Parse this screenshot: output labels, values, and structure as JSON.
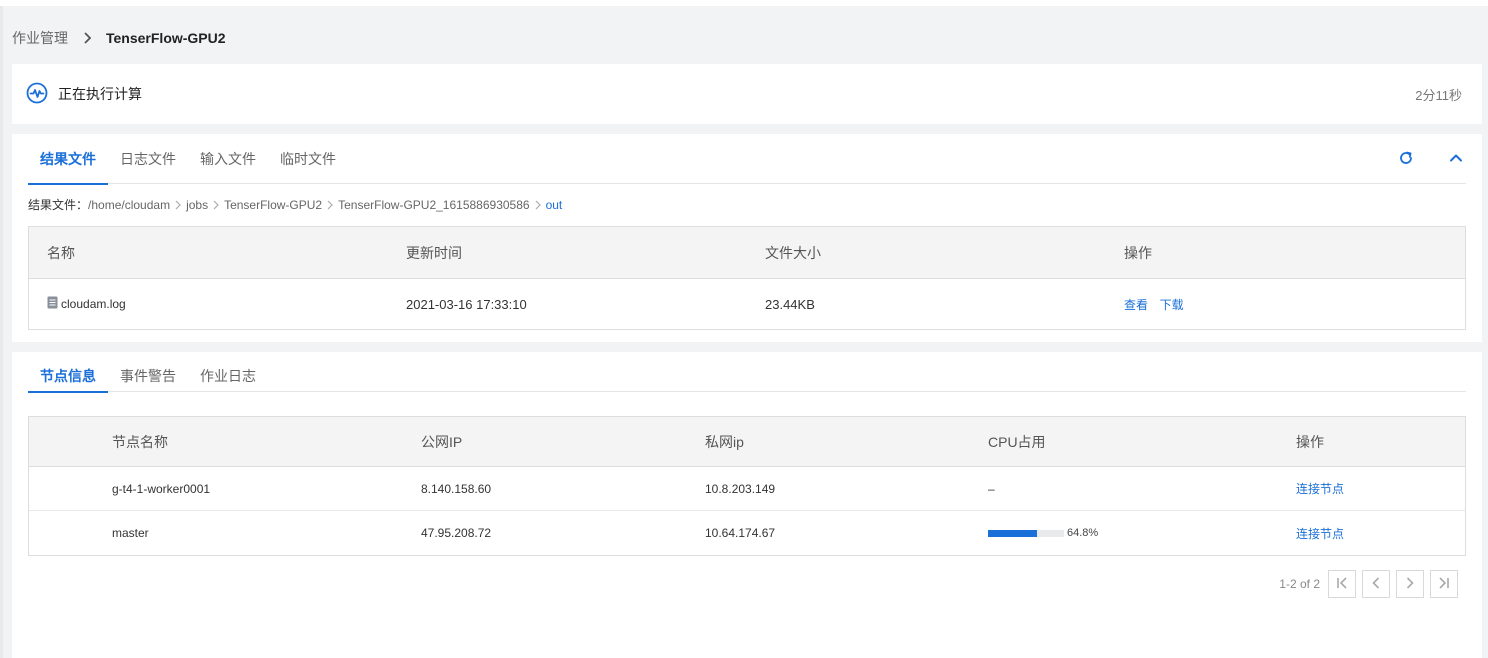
{
  "breadcrumb": {
    "parent": "作业管理",
    "current": "TenserFlow-GPU2"
  },
  "status": {
    "text": "正在执行计算",
    "elapsed": "2分11秒"
  },
  "file_tabs": [
    {
      "label": "结果文件",
      "active": true
    },
    {
      "label": "日志文件",
      "active": false
    },
    {
      "label": "输入文件",
      "active": false
    },
    {
      "label": "临时文件",
      "active": false
    }
  ],
  "path": {
    "label": "结果文件：",
    "segments": [
      "/home/cloudam",
      "jobs",
      "TenserFlow-GPU2",
      "TenserFlow-GPU2_1615886930586",
      "out"
    ]
  },
  "files_table": {
    "headers": [
      "名称",
      "更新时间",
      "文件大小",
      "操作"
    ],
    "rows": [
      {
        "name": "cloudam.log",
        "updated": "2021-03-16 17:33:10",
        "size": "23.44KB",
        "actions": [
          "查看",
          "下载"
        ]
      }
    ]
  },
  "node_tabs": [
    {
      "label": "节点信息",
      "active": true
    },
    {
      "label": "事件警告",
      "active": false
    },
    {
      "label": "作业日志",
      "active": false
    }
  ],
  "nodes_table": {
    "headers": [
      "节点名称",
      "公网IP",
      "私网ip",
      "CPU占用",
      "操作"
    ],
    "rows": [
      {
        "name": "g-t4-1-worker0001",
        "public_ip": "8.140.158.60",
        "private_ip": "10.8.203.149",
        "cpu_text": "–",
        "cpu_percent": null,
        "action": "连接节点"
      },
      {
        "name": "master",
        "public_ip": "47.95.208.72",
        "private_ip": "10.64.174.67",
        "cpu_text": "64.8%",
        "cpu_percent": 64.8,
        "action": "连接节点"
      }
    ]
  },
  "pagination": {
    "range": "1-2 of 2"
  },
  "colors": {
    "accent": "#1a6fd8",
    "background": "#f2f3f5"
  }
}
